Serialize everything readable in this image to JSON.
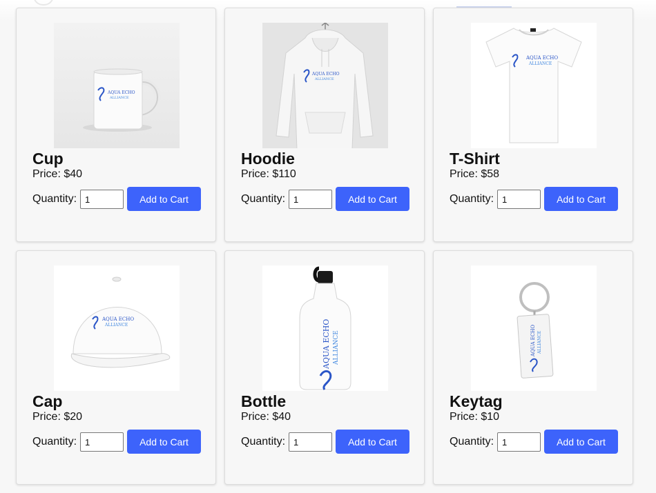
{
  "brand": {
    "line1": "AQUA ECHO",
    "line2": "ALLIANCE",
    "color": "#2a55c7"
  },
  "accent": "#3d63fb",
  "products": [
    {
      "name": "Cup",
      "price": "Price: $40",
      "quantity_label": "Quantity:",
      "quantity": "1",
      "button": "Add to Cart",
      "image_icon": "mug-icon"
    },
    {
      "name": "Hoodie",
      "price": "Price: $110",
      "quantity_label": "Quantity:",
      "quantity": "1",
      "button": "Add to Cart",
      "image_icon": "hoodie-icon"
    },
    {
      "name": "T-Shirt",
      "price": "Price: $58",
      "quantity_label": "Quantity:",
      "quantity": "1",
      "button": "Add to Cart",
      "image_icon": "tshirt-icon"
    },
    {
      "name": "Cap",
      "price": "Price: $20",
      "quantity_label": "Quantity:",
      "quantity": "1",
      "button": "Add to Cart",
      "image_icon": "cap-icon"
    },
    {
      "name": "Bottle",
      "price": "Price: $40",
      "quantity_label": "Quantity:",
      "quantity": "1",
      "button": "Add to Cart",
      "image_icon": "bottle-icon"
    },
    {
      "name": "Keytag",
      "price": "Price: $10",
      "quantity_label": "Quantity:",
      "quantity": "1",
      "button": "Add to Cart",
      "image_icon": "keytag-icon"
    }
  ]
}
